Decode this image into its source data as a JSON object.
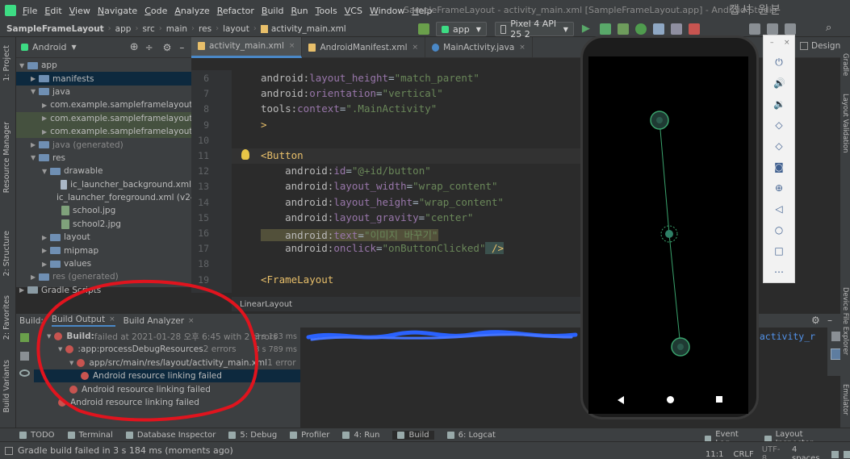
{
  "menu": [
    "File",
    "Edit",
    "View",
    "Navigate",
    "Code",
    "Analyze",
    "Refactor",
    "Build",
    "Run",
    "Tools",
    "VCS",
    "Window",
    "Help"
  ],
  "window_title": "SampleFrameLayout - activity_main.xml [SampleFrameLayout.app] - Android Studio",
  "overlay_text": "캡셔  원본",
  "breadcrumbs": [
    "SampleFrameLayout",
    "app",
    "src",
    "main",
    "res",
    "layout",
    "activity_main.xml"
  ],
  "toolbar": {
    "run_config": "app",
    "device": "Pixel 4 API 25 2"
  },
  "left_tabs": [
    "1: Project",
    "Resource Manager",
    "2: Structure",
    "2: Favorites",
    "Build Variants"
  ],
  "right_tabs": [
    "Gradle",
    "Layout Validation",
    "Device File Explorer",
    "Emulator"
  ],
  "project_panel": {
    "view": "Android"
  },
  "tree": [
    {
      "label": "app",
      "level": 0,
      "icon": "folder",
      "open": true
    },
    {
      "label": "manifests",
      "level": 1,
      "icon": "folder",
      "selected": true
    },
    {
      "label": "java",
      "level": 1,
      "icon": "folder",
      "open": true
    },
    {
      "label": "com.example.sampleframelayout",
      "level": 2,
      "icon": "package"
    },
    {
      "label": "com.example.sampleframelayout (",
      "level": 2,
      "icon": "package",
      "highlight": true
    },
    {
      "label": "com.example.sampleframelayout (",
      "level": 2,
      "icon": "package",
      "highlight": true
    },
    {
      "label": "java (generated)",
      "level": 1,
      "icon": "folder",
      "gray": true
    },
    {
      "label": "res",
      "level": 1,
      "icon": "folder",
      "open": true
    },
    {
      "label": "drawable",
      "level": 2,
      "icon": "folder",
      "open": true
    },
    {
      "label": "ic_launcher_background.xml",
      "level": 3,
      "icon": "file"
    },
    {
      "label": "ic_launcher_foreground.xml (v24)",
      "level": 3,
      "icon": "file"
    },
    {
      "label": "school.jpg",
      "level": 3,
      "icon": "image"
    },
    {
      "label": "school2.jpg",
      "level": 3,
      "icon": "image"
    },
    {
      "label": "layout",
      "level": 2,
      "icon": "folder"
    },
    {
      "label": "mipmap",
      "level": 2,
      "icon": "folder"
    },
    {
      "label": "values",
      "level": 2,
      "icon": "folder"
    },
    {
      "label": "res (generated)",
      "level": 1,
      "icon": "folder",
      "gray": true
    },
    {
      "label": "Gradle Scripts",
      "level": 0,
      "icon": "gradle"
    }
  ],
  "editor_tabs": [
    {
      "label": "activity_main.xml",
      "active": true
    },
    {
      "label": "AndroidManifest.xml",
      "active": false
    },
    {
      "label": "MainActivity.java",
      "active": false
    }
  ],
  "design_label": "Design",
  "line_numbers": [
    "6",
    "7",
    "8",
    "9",
    "10",
    "11",
    "12",
    "13",
    "14",
    "15",
    "16",
    "17",
    "18",
    "19"
  ],
  "code_lines": [
    [
      {
        "t": "android:",
        "c": "ns"
      },
      {
        "t": "layout_height",
        "c": "attr"
      },
      {
        "t": "=",
        "c": "p"
      },
      {
        "t": "\"match_parent\"",
        "c": "val"
      }
    ],
    [
      {
        "t": "android:",
        "c": "ns"
      },
      {
        "t": "orientation",
        "c": "attr"
      },
      {
        "t": "=",
        "c": "p"
      },
      {
        "t": "\"vertical\"",
        "c": "val"
      }
    ],
    [
      {
        "t": "tools:",
        "c": "ns"
      },
      {
        "t": "context",
        "c": "attr"
      },
      {
        "t": "=",
        "c": "p"
      },
      {
        "t": "\".MainActivity\"",
        "c": "val"
      }
    ],
    [
      {
        "t": ">",
        "c": "tag"
      }
    ],
    [],
    [
      {
        "t": "<Button",
        "c": "tag"
      }
    ],
    [
      {
        "t": "    android:",
        "c": "ns"
      },
      {
        "t": "id",
        "c": "attr"
      },
      {
        "t": "=",
        "c": "p"
      },
      {
        "t": "\"@+id/button\"",
        "c": "val"
      }
    ],
    [
      {
        "t": "    android:",
        "c": "ns"
      },
      {
        "t": "layout_width",
        "c": "attr"
      },
      {
        "t": "=",
        "c": "p"
      },
      {
        "t": "\"wrap_content\"",
        "c": "val"
      }
    ],
    [
      {
        "t": "    android:",
        "c": "ns"
      },
      {
        "t": "layout_height",
        "c": "attr"
      },
      {
        "t": "=",
        "c": "p"
      },
      {
        "t": "\"wrap_content\"",
        "c": "val"
      }
    ],
    [
      {
        "t": "    android:",
        "c": "ns"
      },
      {
        "t": "layout_gravity",
        "c": "attr"
      },
      {
        "t": "=",
        "c": "p"
      },
      {
        "t": "\"center\"",
        "c": "val"
      }
    ],
    [
      {
        "t": "    android:",
        "c": "ns"
      },
      {
        "t": "text",
        "c": "attr"
      },
      {
        "t": "=",
        "c": "p"
      },
      {
        "t": "\"이미지 바꾸기\"",
        "c": "val"
      }
    ],
    [
      {
        "t": "    android:",
        "c": "ns"
      },
      {
        "t": "onclick",
        "c": "attr"
      },
      {
        "t": "=",
        "c": "p"
      },
      {
        "t": "\"onButtonClicked\"",
        "c": "val"
      },
      {
        "t": " />",
        "c": "tag"
      }
    ],
    [],
    [
      {
        "t": "<FrameLayout",
        "c": "tag"
      }
    ]
  ],
  "breadcrumb_bottom": "LinearLayout",
  "build_tabs": [
    {
      "label": "Build:",
      "active": false
    },
    {
      "label": "Build Output",
      "active": true
    },
    {
      "label": "Build Analyzer",
      "active": false
    }
  ],
  "build_tree": [
    {
      "label": "Build:",
      "suffix": " failed at 2021-01-28 오후 6:45 with 2 errors",
      "time": "3 s 183 ms",
      "level": 0,
      "bold": true
    },
    {
      "label": ":app:processDebugResources",
      "suffix": "  2 errors",
      "time": "3 s 789 ms",
      "level": 1
    },
    {
      "label": "app/src/main/res/layout/activity_main.xml",
      "suffix": "  1 error",
      "time": "",
      "level": 2
    },
    {
      "label": "Android resource linking failed",
      "suffix": "",
      "time": "",
      "level": 3,
      "selected": true
    },
    {
      "label": "Android resource linking failed",
      "suffix": "",
      "time": "",
      "level": 2
    },
    {
      "label": "Android resource linking failed",
      "suffix": "",
      "time": "",
      "level": 1
    }
  ],
  "build_output_text": ":\\activity_r",
  "bottom_tabs": [
    "TODO",
    "Terminal",
    "Database Inspector",
    "5: Debug",
    "Profiler",
    "4: Run",
    "Build",
    "6: Logcat"
  ],
  "bottom_right": [
    "Event Log",
    "Layout Inspector"
  ],
  "status": {
    "message": "Gradle build failed in 3 s 184 ms (moments ago)",
    "position": "11:1",
    "line_sep": "CRLF",
    "encoding": "UTF-8",
    "indent": "4 spaces"
  },
  "emulator_icons": [
    "power-icon",
    "volume-up-icon",
    "volume-down-icon",
    "rotate-left-icon",
    "rotate-right-icon",
    "camera-icon",
    "zoom-icon",
    "back-icon",
    "home-icon",
    "overview-icon",
    "more-icon"
  ],
  "colors": {
    "accent": "#4a88c7",
    "error": "#c75450",
    "annotation_red": "#e0141e"
  }
}
